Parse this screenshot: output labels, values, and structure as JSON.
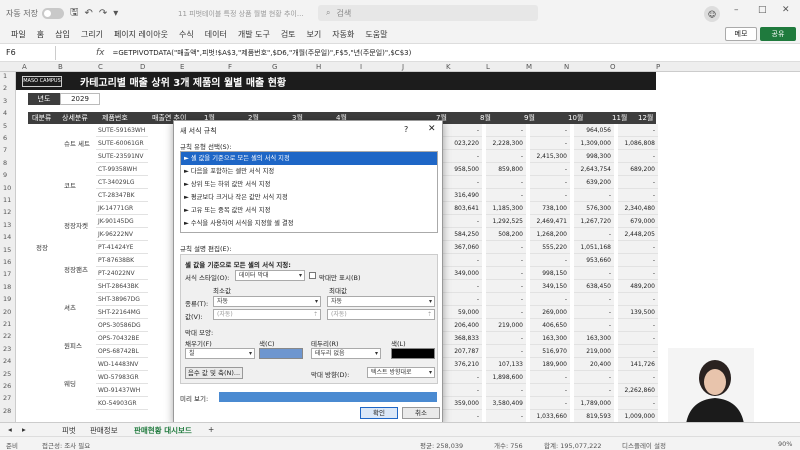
{
  "titlebar": {
    "autosave_label": "자동 저장",
    "autosave_state": "끔",
    "filename": "11 피벗테이블 특정 상품 월별 현황 추이...",
    "search_placeholder": "검색",
    "avatar": "☺"
  },
  "ribbon": {
    "tabs": [
      "파일",
      "홈",
      "삽입",
      "그리기",
      "페이지 레이아웃",
      "수식",
      "데이터",
      "개발 도구",
      "검토",
      "보기",
      "자동화",
      "도움말"
    ],
    "memo_label": "메모",
    "share_label": "공유"
  },
  "formula_bar": {
    "cell_ref": "F6",
    "fx": "fx",
    "formula": "=GETPIVOTDATA(\"매출액\",피벗!$A$3,\"제품번호\",$D6,\"개월(주문일)\",F$5,\"년(주문일)\",$C$3)"
  },
  "columns": [
    "A",
    "B",
    "C",
    "D",
    "E",
    "F",
    "G",
    "H",
    "I",
    "J",
    "K",
    "L",
    "M",
    "N",
    "O",
    "P"
  ],
  "rows": [
    "1",
    "2",
    "3",
    "4",
    "5",
    "6",
    "7",
    "8",
    "9",
    "10",
    "11",
    "12",
    "13",
    "14",
    "15",
    "16",
    "17",
    "18",
    "19",
    "20",
    "21",
    "22",
    "23",
    "24",
    "25",
    "26",
    "27",
    "28"
  ],
  "sheet": {
    "logo": "MASO CAMPUS",
    "title": "카테고리별 매출 상위 3개 제품의 월별 매출 현황",
    "year_label": "년도",
    "year_value": "2029",
    "headers": [
      "대분류",
      "상세분류",
      "제품번호",
      "매출연 추이",
      "1월",
      "2월",
      "3월",
      "4월",
      "5월",
      "6월",
      "7월",
      "8월",
      "9월",
      "10월",
      "11월",
      "12월"
    ],
    "main_category": "정장",
    "subcategories": [
      "슈트 세트",
      "코트",
      "정장자켓",
      "정장팬츠",
      "셔츠",
      "원피스",
      "웨딩"
    ],
    "codes": [
      "SUTE-59163WH",
      "SUTE-60061GR",
      "SUTE-23591NV",
      "CT-99358WH",
      "CT-34029LG",
      "CT-28347BK",
      "JK-14771GR",
      "JK-90145DG",
      "JK-96222NV",
      "PT-41424YE",
      "PT-87638BK",
      "PT-24022NV",
      "SHT-28643BK",
      "SHT-38967DG",
      "SHT-22164MG",
      "OPS-30586DG",
      "OPS-70432BE",
      "OPS-68742BL",
      "WD-14483NV",
      "WD-57983GR",
      "WD-91437WH",
      "KO-54903GR"
    ],
    "visible_values": [
      [
        "-",
        "-",
        "-",
        "964,056",
        "-"
      ],
      [
        "023,220",
        "2,228,300",
        "-",
        "1,309,000",
        "1,086,808"
      ],
      [
        "-",
        "-",
        "2,415,300",
        "998,300",
        "-"
      ],
      [
        "958,500",
        "859,800",
        "-",
        "2,643,754",
        "689,200"
      ],
      [
        "-",
        "-",
        "-",
        "639,200",
        "-"
      ],
      [
        "316,490",
        "-",
        "-",
        "-",
        "-"
      ],
      [
        "803,641",
        "1,185,300",
        "738,100",
        "576,300",
        "2,340,480"
      ],
      [
        "-",
        "1,292,525",
        "2,469,471",
        "1,267,720",
        "679,000"
      ],
      [
        "584,250",
        "508,200",
        "1,268,200",
        "-",
        "2,448,205"
      ],
      [
        "367,060",
        "-",
        "555,220",
        "1,051,168",
        "-"
      ],
      [
        "-",
        "-",
        "-",
        "953,660",
        "-"
      ],
      [
        "349,000",
        "-",
        "998,150",
        "-",
        "-"
      ],
      [
        "-",
        "-",
        "349,150",
        "638,450",
        "489,200"
      ],
      [
        "-",
        "-",
        "-",
        "-",
        "-"
      ],
      [
        "59,000",
        "-",
        "269,000",
        "-",
        "139,500"
      ],
      [
        "206,400",
        "219,000",
        "406,650",
        "-",
        "-"
      ],
      [
        "368,833",
        "-",
        "163,300",
        "163,300",
        "-"
      ],
      [
        "207,787",
        "-",
        "516,970",
        "219,000",
        "-"
      ],
      [
        "376,210",
        "107,133",
        "189,900",
        "20,400",
        "141,726"
      ],
      [
        "-",
        "1,898,600",
        "-",
        "-",
        "-"
      ],
      [
        "-",
        "-",
        "-",
        "-",
        "2,262,860"
      ],
      [
        "359,000",
        "3,580,409",
        "-",
        "1,789,000",
        "-"
      ],
      [
        "-",
        "-",
        "1,033,660",
        "819,593",
        "1,009,000"
      ]
    ]
  },
  "dialog": {
    "title": "새 서식 규칙",
    "help": "?",
    "close": "✕",
    "rule_type_label": "규칙 유형 선택(S):",
    "rules": [
      "► 셀 값을 기준으로 모든 셀의 서식 지정",
      "► 다음을 포함하는 셀만 서식 지정",
      "► 상위 또는 하위 값만 서식 지정",
      "► 평균보다 크거나 작은 값만 서식 지정",
      "► 고유 또는 중복 값만 서식 지정",
      "► 수식을 사용하여 서식을 지정할 셀 결정"
    ],
    "desc_label": "규칙 설명 편집(E):",
    "desc_heading": "셀 값을 기준으로 모든 셀의 서식 지정:",
    "format_style_label": "서식 스타일(O):",
    "format_style_value": "데이터 막대",
    "show_bar_only": "막대만 표시(B)",
    "min_label": "최소값",
    "max_label": "최대값",
    "type_label": "종류(T):",
    "value_label": "값(V):",
    "min_type": "자동",
    "max_type": "자동",
    "min_value": "(자동)",
    "max_value": "(자동)",
    "bar_appearance": "막대 모양:",
    "fill_label": "채우기(F)",
    "color_label": "색(C)",
    "border_label": "테두리(R)",
    "border_color_label": "색(L)",
    "fill_value": "칠",
    "border_value": "테두리 없음",
    "neg_axis_btn": "음수 값 및 축(N)...",
    "bar_direction_label": "막대 방향(D):",
    "bar_direction_value": "텍스트 방향대로",
    "preview_label": "미리 보기:",
    "ok": "확인",
    "cancel": "취소",
    "bar_color": "#6e96cf",
    "border_color": "#000000",
    "selection_color": "#1e66c6"
  },
  "sheet_tabs": [
    "피벗",
    "판매정보",
    "판매현황 대시보드"
  ],
  "statusbar": {
    "ready": "준비",
    "accessibility": "접근성: 조사 필요",
    "average": "평균: 258,039",
    "count": "개수: 756",
    "sum": "합계: 195,077,222",
    "display_settings": "디스플레이 설정",
    "zoom": "90%"
  }
}
